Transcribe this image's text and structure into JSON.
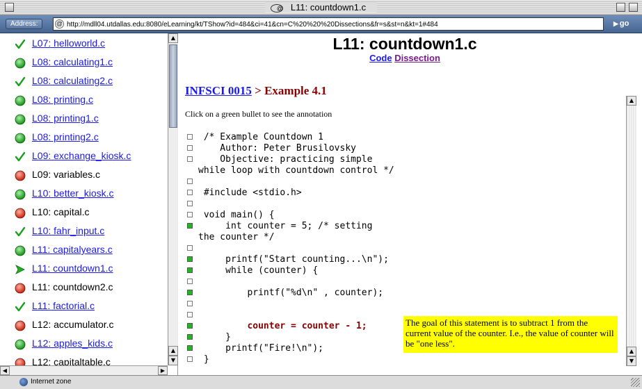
{
  "window": {
    "title": "L11: countdown1.c"
  },
  "address": {
    "label": "Address:",
    "url": "http://mdll04.utdallas.edu:8080/eLearning/kt/TShow?id=484&ci=41&cn=C%20%20%20Dissections&fr=s&st=n&kt=1#484",
    "go_label": "go"
  },
  "lessons": [
    {
      "label": "L07: helloworld.c",
      "status": "check",
      "link": true
    },
    {
      "label": "L08: calculating1.c",
      "status": "green",
      "link": true
    },
    {
      "label": "L08: calculating2.c",
      "status": "check",
      "link": true
    },
    {
      "label": "L08: printing.c",
      "status": "green",
      "link": true
    },
    {
      "label": "L08: printing1.c",
      "status": "green",
      "link": true
    },
    {
      "label": "L08: printing2.c",
      "status": "green",
      "link": true
    },
    {
      "label": "L09: exchange_kiosk.c",
      "status": "check",
      "link": true
    },
    {
      "label": "L09: variables.c",
      "status": "red",
      "link": false
    },
    {
      "label": "L10: better_kiosk.c",
      "status": "green",
      "link": true
    },
    {
      "label": "L10: capital.c",
      "status": "red",
      "link": false
    },
    {
      "label": "L10: fahr_input.c",
      "status": "check",
      "link": true
    },
    {
      "label": "L11: capitalyears.c",
      "status": "green",
      "link": true
    },
    {
      "label": "L11: countdown1.c",
      "status": "current",
      "link": true
    },
    {
      "label": "L11: countdown2.c",
      "status": "red",
      "link": false
    },
    {
      "label": "L11: factorial.c",
      "status": "check",
      "link": true
    },
    {
      "label": "L12: accumulator.c",
      "status": "red",
      "link": false
    },
    {
      "label": "L12: apples_kids.c",
      "status": "green",
      "link": true
    },
    {
      "label": "L12: capitaltable.c",
      "status": "red",
      "link": false
    }
  ],
  "page": {
    "title": "L11: countdown1.c",
    "code_link": "Code",
    "dissection_link": "Dissection",
    "breadcrumb_course": "INFSCI 0015",
    "breadcrumb_sep": " > ",
    "breadcrumb_current": "Example 4.1",
    "instruction": "Click on a green bullet to see the annotation"
  },
  "code_lines": [
    {
      "text": " /* Example Countdown 1",
      "bullet": "grey"
    },
    {
      "text": "    Author: Peter Brusilovsky",
      "bullet": "grey"
    },
    {
      "text": "    Objective: practicing simple",
      "bullet": "grey"
    },
    {
      "text": "while loop with countdown control */",
      "bullet": "none"
    },
    {
      "text": "",
      "bullet": "grey"
    },
    {
      "text": " #include <stdio.h>",
      "bullet": "grey"
    },
    {
      "text": "",
      "bullet": "grey"
    },
    {
      "text": " void main() {",
      "bullet": "grey"
    },
    {
      "text": "     int counter = 5; /* setting",
      "bullet": "green"
    },
    {
      "text": "the counter */",
      "bullet": "none"
    },
    {
      "text": "",
      "bullet": "grey"
    },
    {
      "text": "     printf(\"Start counting...\\n\");",
      "bullet": "green"
    },
    {
      "text": "     while (counter) {",
      "bullet": "green"
    },
    {
      "text": "",
      "bullet": "grey"
    },
    {
      "text": "         printf(\"%d\\n\" , counter);",
      "bullet": "green"
    },
    {
      "text": "",
      "bullet": "grey"
    },
    {
      "text": "",
      "bullet": "grey"
    },
    {
      "text": "         counter = counter - 1;",
      "bullet": "green",
      "highlight": true
    },
    {
      "text": "     }",
      "bullet": "green"
    },
    {
      "text": "     printf(\"Fire!\\n\");",
      "bullet": "green"
    },
    {
      "text": " }",
      "bullet": "grey"
    }
  ],
  "annotation": {
    "text": "The goal of this statement is to subtract 1 from the current value of the counter. I.e., the value of counter will be \"one less\"."
  },
  "status": {
    "zone": "Internet zone"
  }
}
